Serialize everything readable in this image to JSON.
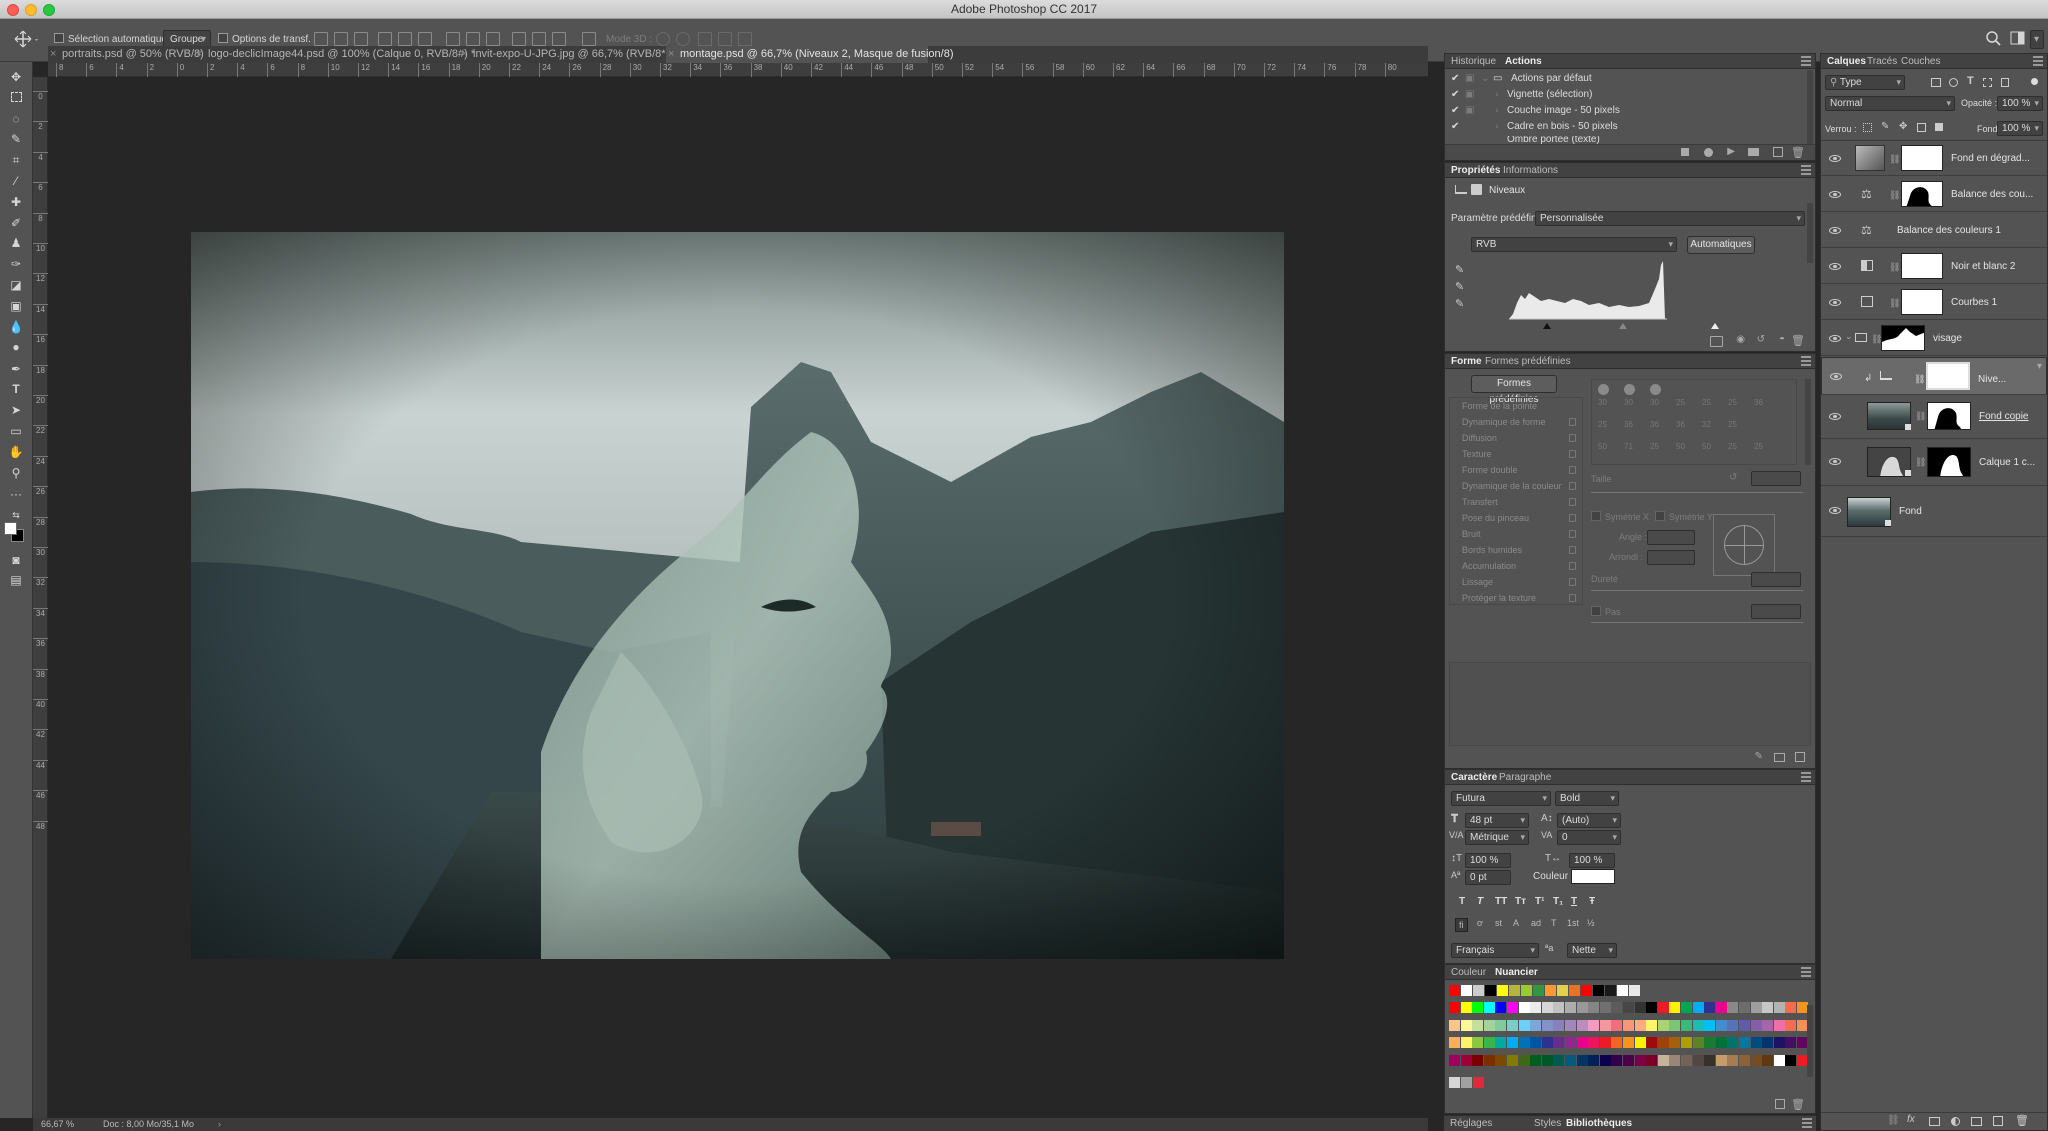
{
  "window": {
    "title": "Adobe Photoshop CC 2017"
  },
  "options_bar": {
    "auto_select_label": "Sélection automatique :",
    "auto_select_value": "Groupe",
    "transform_controls_label": "Options de transf.",
    "mode_3d_label": "Mode 3D :"
  },
  "tabs": [
    {
      "label": "portraits.psd @ 50% (RVB/8)"
    },
    {
      "label": "logo-declicImage44.psd @ 100% (Calque 0, RVB/8#) *"
    },
    {
      "label": "invit-expo-U-JPG.jpg @ 66,7% (RVB/8*)"
    },
    {
      "label": "montage.psd @ 66,7% (Niveaux 2, Masque de fusion/8)"
    }
  ],
  "ruler": {
    "h_ticks": [
      "8",
      "6",
      "4",
      "2",
      "0",
      "2",
      "4",
      "6",
      "8",
      "10",
      "12",
      "14",
      "16",
      "18",
      "20",
      "22",
      "24",
      "26",
      "28",
      "30",
      "32",
      "34",
      "36",
      "38",
      "40",
      "42",
      "44",
      "46",
      "48",
      "50",
      "52",
      "54",
      "56",
      "58",
      "60",
      "62",
      "64",
      "66",
      "68",
      "70",
      "72",
      "74",
      "76",
      "78",
      "80"
    ],
    "v_ticks": [
      "0",
      "2",
      "4",
      "6",
      "8",
      "10",
      "12",
      "14",
      "16",
      "18",
      "20",
      "22",
      "24",
      "26",
      "28",
      "30",
      "32",
      "34",
      "36",
      "38",
      "40",
      "42",
      "44",
      "46",
      "48"
    ]
  },
  "status": {
    "zoom": "66,67 %",
    "doc": "Doc : 8,00 Mo/35,1 Mo"
  },
  "history_panel": {
    "tabs": [
      "Historique",
      "Actions"
    ],
    "items": [
      {
        "label": "Actions par défaut"
      },
      {
        "label": "Vignette (sélection)"
      },
      {
        "label": "Couche image - 50 pixels"
      },
      {
        "label": "Cadre en bois - 50 pixels"
      },
      {
        "label": "Ombre portée (texte)"
      }
    ]
  },
  "properties_panel": {
    "tabs": [
      "Propriétés",
      "Informations"
    ],
    "adjustment_label": "Niveaux",
    "preset_label": "Paramètre prédéfini :",
    "preset_value": "Personnalisée",
    "channel_value": "RVB",
    "auto_button": "Automatiques"
  },
  "brush_panel": {
    "tabs": [
      "Forme",
      "Formes prédéfinies"
    ],
    "preset_button": "Formes prédéfinies",
    "options": [
      "Forme de la pointe",
      "Dynamique de forme",
      "Diffusion",
      "Texture",
      "Forme double",
      "Dynamique de la couleur",
      "Transfert",
      "Pose du pinceau",
      "Bruit",
      "Bords humides",
      "Accumulation",
      "Lissage",
      "Protéger la texture"
    ],
    "size_nums": [
      "30",
      "30",
      "30",
      "25",
      "25",
      "25",
      "36",
      "25",
      "36",
      "36",
      "36",
      "32",
      "25",
      "50",
      "71",
      "25",
      "50",
      "50",
      "25",
      "25"
    ],
    "size_label": "Taille",
    "flip_x": "Symétrie X",
    "flip_y": "Symétrie Y",
    "angle_label": "Angle :",
    "roundness_label": "Arrondi :",
    "hardness_label": "Dureté",
    "spacing_label": "Pas"
  },
  "character_panel": {
    "tabs": [
      "Caractère",
      "Paragraphe"
    ],
    "font_family": "Futura",
    "font_style": "Bold",
    "font_size": "48 pt",
    "leading": "(Auto)",
    "kerning": "Métrique",
    "tracking": "0",
    "vscale": "100 %",
    "hscale": "100 %",
    "baseline": "0 pt",
    "color_label": "Couleur :",
    "styles": [
      "T",
      "T",
      "TT",
      "Tт",
      "T¹",
      "T₁",
      "T",
      "Ŧ"
    ],
    "opentype": [
      "fi",
      "ơ",
      "st",
      "A",
      "ad",
      "T",
      "1st",
      "½"
    ],
    "language": "Français",
    "antialias": "Nette"
  },
  "swatches_panel": {
    "tabs": [
      "Couleur",
      "Nuancier"
    ],
    "colors": [
      [
        "#ff0000",
        "#ffff00",
        "#00ff00",
        "#00ffff",
        "#0000ff",
        "#ff00ff",
        "#ffffff",
        "#ebebeb",
        "#d6d6d6",
        "#c2c2c2",
        "#adadad",
        "#999999",
        "#858585",
        "#707070",
        "#5c5c5c",
        "#474747",
        "#333333",
        "#000000",
        "#ed1c24",
        "#fff200",
        "#00a651",
        "#00aeef",
        "#2e3192",
        "#ec008c",
        "#898989",
        "#6d6d6d",
        "#9e9e9e",
        "#c7c7c7",
        "#b3b3b3",
        "#f26c4f",
        "#f7941d"
      ],
      [
        "#fdc689",
        "#fff799",
        "#c4df9b",
        "#a2d39c",
        "#82ca9d",
        "#7bcdc8",
        "#6dcff6",
        "#7da7d8",
        "#8393ca",
        "#8781bd",
        "#a187be",
        "#bd8cbf",
        "#f49ac1",
        "#f5989d",
        "#f26d7d",
        "#f7977a",
        "#f9ad81",
        "#fff568",
        "#acd373",
        "#7cc576",
        "#3cb878",
        "#1cbbb4",
        "#00bff3",
        "#448ccb",
        "#5674b9",
        "#605ca8",
        "#855fa8",
        "#a864a8",
        "#f06eaa",
        "#f26c4f",
        "#f68e56"
      ],
      [
        "#fbaf5d",
        "#fff467",
        "#8dc63f",
        "#39b54a",
        "#00a99d",
        "#00aeef",
        "#0072bc",
        "#0054a6",
        "#2e3192",
        "#662d91",
        "#92278f",
        "#ec008c",
        "#ed145b",
        "#ed1c24",
        "#f26522",
        "#f7941d",
        "#fff200",
        "#9e0b0f",
        "#a0410d",
        "#a3620a",
        "#aba000",
        "#598527",
        "#197b30",
        "#007236",
        "#00746b",
        "#0076a3",
        "#004b80",
        "#003471",
        "#1b1464",
        "#440e62",
        "#630460"
      ],
      [
        "#9e005d",
        "#9e0039",
        "#790000",
        "#7b2e00",
        "#7d4900",
        "#827b00",
        "#406618",
        "#005e20",
        "#005826",
        "#005952",
        "#005b7f",
        "#003663",
        "#002157",
        "#0d004c",
        "#32004b",
        "#4b0049",
        "#7b0046",
        "#7a0026",
        "#c7b299",
        "#998675",
        "#736357",
        "#534741",
        "#37302d",
        "#c69c6d",
        "#a67c52",
        "#8c6239",
        "#754c24",
        "#603913",
        "#ffffff",
        "#000000",
        "#ed1c24"
      ]
    ],
    "top_row": [
      "#ff0000",
      "#ffffff",
      "#cccccc",
      "#000000",
      "#ffff00",
      "#b5b53d",
      "#99cc33",
      "#2e9940",
      "#ff9933",
      "#e0d04a",
      "#e37524",
      "#ff0000",
      "#000000",
      "#1a1a1a",
      "#ffffff",
      "#e8e8e8"
    ],
    "last_row": [
      "#d6d6d6",
      "#a1a1a1",
      "#dc2b3b"
    ]
  },
  "layers_panel": {
    "tabs": [
      "Calques",
      "Tracés",
      "Couches"
    ],
    "filter_value": "Type",
    "blend_mode": "Normal",
    "opacity_label": "Opacité :",
    "opacity_value": "100 %",
    "lock_label": "Verrou :",
    "fill_label": "Fond :",
    "fill_value": "100 %",
    "layers": [
      {
        "name": "Fond en dégrad..."
      },
      {
        "name": "Balance des cou..."
      },
      {
        "name": "Balance des couleurs 1"
      },
      {
        "name": "Noir et blanc 2"
      },
      {
        "name": "Courbes 1"
      },
      {
        "name": "visage"
      },
      {
        "name": "Nive..."
      },
      {
        "name": "Fond copie"
      },
      {
        "name": "Calque 1 c..."
      },
      {
        "name": "Fond"
      }
    ]
  },
  "bottom_tabs": [
    "Réglages",
    "Styles",
    "Bibliothèques"
  ]
}
